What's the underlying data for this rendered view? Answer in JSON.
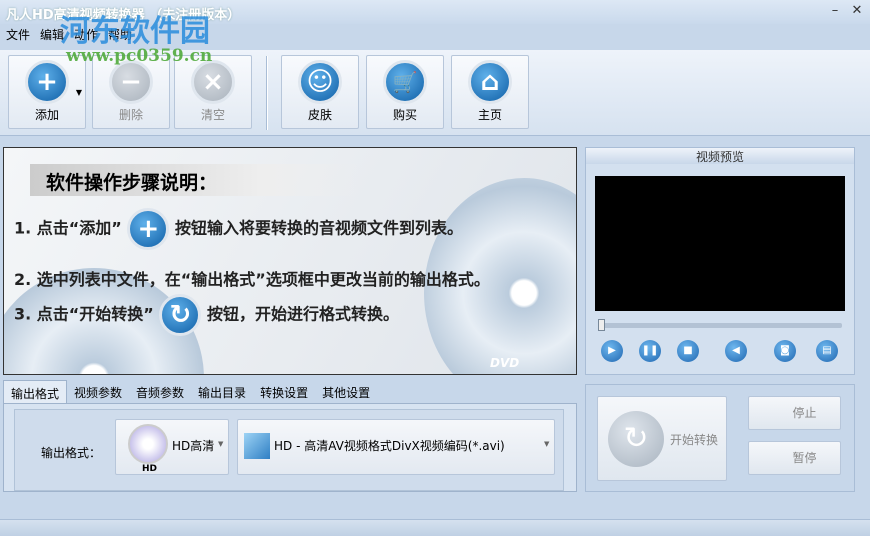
{
  "window": {
    "title": "凡人HD高清视频转换器 （未注册版本）",
    "minimize": "–",
    "close": "✕"
  },
  "menu": [
    "文件",
    "编辑",
    "动作",
    "帮助"
  ],
  "watermark": {
    "name": "河东软件园",
    "url": "www.pc0359.cn"
  },
  "toolbar": {
    "add": "添加",
    "delete": "删除",
    "clear": "清空",
    "skin": "皮肤",
    "buy": "购买",
    "home": "主页"
  },
  "guide": {
    "title": "软件操作步骤说明：",
    "step1a": "1. 点击“添加”",
    "step1b": "按钮输入将要转换的音视频文件到列表。",
    "step2": "2. 选中列表中文件，在“输出格式”选项框中更改当前的输出格式。",
    "step3a": "3. 点击“开始转换”",
    "step3b": "按钮，开始进行格式转换。",
    "dvd": "DVD"
  },
  "preview": {
    "title": "视频预览",
    "progress": 0
  },
  "tabs": [
    "输出格式",
    "视频参数",
    "音频参数",
    "输出目录",
    "转换设置",
    "其他设置"
  ],
  "output": {
    "label": "输出格式：",
    "category": "HD高清",
    "category_badge": "HD",
    "format": "HD - 高清AV视频格式DivX视频编码(*.avi)"
  },
  "actions": {
    "start": "开始转换",
    "stop": "停止",
    "pause": "暂停"
  }
}
